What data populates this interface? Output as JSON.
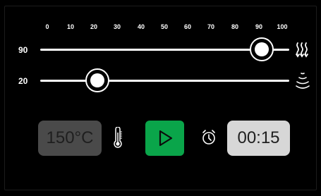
{
  "scale": {
    "ticks": [
      "0",
      "10",
      "20",
      "30",
      "40",
      "50",
      "60",
      "70",
      "80",
      "90",
      "100"
    ]
  },
  "sliders": [
    {
      "label": "90",
      "value": 90,
      "min": 0,
      "max": 100,
      "icon": "heat-waves-icon"
    },
    {
      "label": "20",
      "value": 20,
      "min": 0,
      "max": 100,
      "icon": "fan-waves-icon"
    }
  ],
  "controls": {
    "temperature": "150°C",
    "temperature_icon": "thermometer-icon",
    "play_icon": "play-icon",
    "timer_icon": "alarm-clock-icon",
    "time": "00:15"
  },
  "colors": {
    "background": "#000000",
    "play_button": "#0aa54a",
    "temperature_box": "#4a4a4a",
    "time_box": "#d7d7d7",
    "track": "#ffffff"
  }
}
